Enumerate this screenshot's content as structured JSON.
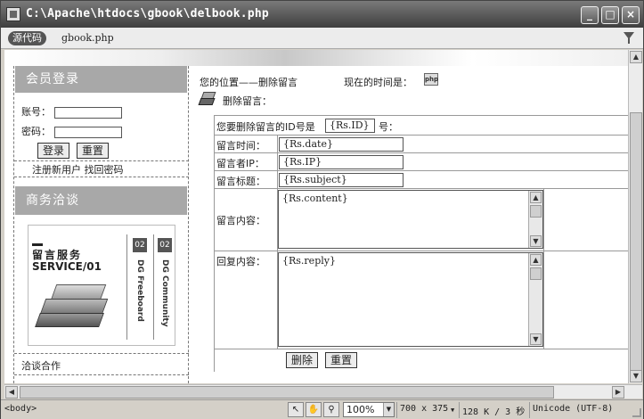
{
  "window": {
    "title": "C:\\Apache\\htdocs\\gbook\\delbook.php",
    "min_glyph": "_",
    "max_glyph": "□",
    "close_glyph": "×"
  },
  "docbar": {
    "source_label": "源代码",
    "document_name": "gbook.php"
  },
  "sidebar": {
    "login_title": "会员登录",
    "account_label": "账号：",
    "password_label": "密码：",
    "login_button": "登录",
    "reset_button": "重置",
    "register_link": "注册新用户",
    "forgot_link": "找回密码",
    "business_title": "商务洽谈",
    "ad": {
      "line1": "留言服务",
      "line2": "SERVICE/01",
      "badge1": "02",
      "vtext1": "DG Freeboard",
      "badge2": "02",
      "vtext2": "DG Community"
    },
    "cooperation_link": "洽谈合作"
  },
  "main": {
    "position_text": "您的位置——删除留言",
    "time_label": "现在的时间是：",
    "php_icon_text": "php",
    "delete_heading": "删除留言：",
    "confirm_prefix": "您要删除留言的ID号是",
    "id_value": "{Rs.ID}",
    "confirm_suffix": "号：",
    "date_label": "留言时间：",
    "date_value": "{Rs.date}",
    "ip_label": "留言者IP：",
    "ip_value": "{Rs.IP}",
    "subject_label": "留言标题：",
    "subject_value": "{Rs.subject}",
    "content_label": "留言内容：",
    "content_value": "{Rs.content}",
    "reply_label": "回复内容：",
    "reply_value": "{Rs.reply}",
    "delete_button": "删除",
    "reset_button": "重置"
  },
  "statusbar": {
    "tag": "<body>",
    "zoom": "100%",
    "dimensions": "700 x 375",
    "filesize": "128 K / 3 秒",
    "encoding": "Unicode (UTF-8)"
  }
}
